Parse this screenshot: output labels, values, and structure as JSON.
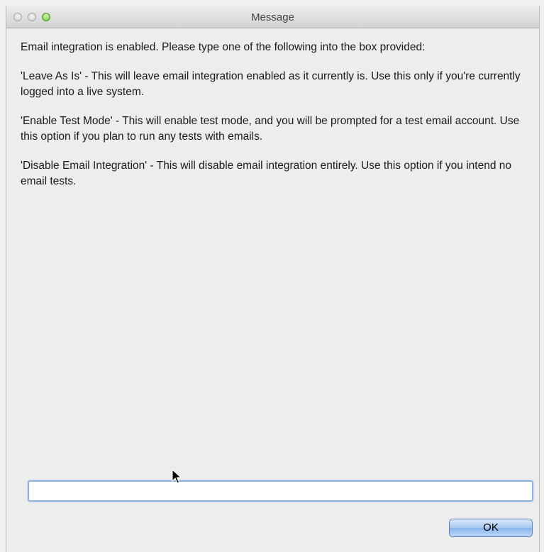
{
  "window": {
    "title": "Message"
  },
  "message": {
    "intro": "Email integration is enabled. Please type one of the following into the box provided:",
    "options": [
      "'Leave As Is' - This will leave email integration enabled as it currently is. Use this only if you're currently logged into a live system.",
      "'Enable Test Mode' - This will enable test mode, and you will be prompted for a test email account. Use this option if you plan to run any tests with emails.",
      "'Disable Email Integration' - This will disable email integration entirely. Use this option if you intend no email tests."
    ]
  },
  "input": {
    "value": "",
    "placeholder": ""
  },
  "buttons": {
    "ok_label": "OK"
  },
  "colors": {
    "button_accent": "#a7c8f1",
    "focus_ring": "#8fb3e3"
  }
}
